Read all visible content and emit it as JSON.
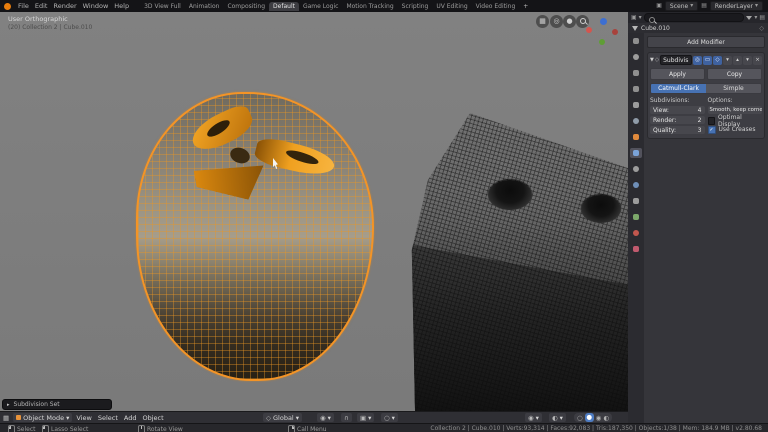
{
  "glyphs": {
    "down": "▾",
    "up": "▴",
    "right": "▸",
    "tri_down": "▼",
    "close": "×",
    "check": "✓",
    "plus": "+",
    "grid": "▦",
    "camera": "◎",
    "hand": "●",
    "target": "◉",
    "half": "◐",
    "circle": "○",
    "diamond": "◇",
    "magnet": "∩",
    "box": "▣",
    "rows": "▤",
    "world": "◍",
    "monitor": "▭"
  },
  "topbar": {
    "menus": [
      "File",
      "Edit",
      "Render",
      "Window",
      "Help"
    ],
    "tabs": [
      "3D View Full",
      "Animation",
      "Compositing",
      "Default",
      "Game Logic",
      "Motion Tracking",
      "Scripting",
      "UV Editing",
      "Video Editing"
    ],
    "active_tab": "Default",
    "scene_label": "Scene",
    "render_layer_label": "RenderLayer"
  },
  "viewport": {
    "view_label": "User Orthographic",
    "context_label": "(20) Collection 2 | Cube.010"
  },
  "outliner": {
    "item": "Cube.010"
  },
  "properties": {
    "tabs": [
      "editor-type",
      "render",
      "output",
      "view-layer",
      "scene",
      "world",
      "object",
      "modifiers",
      "particles",
      "physics",
      "constraints",
      "object-data",
      "material",
      "texture"
    ],
    "active_tab": "modifiers",
    "add_modifier_label": "Add Modifier",
    "modifier": {
      "name": "Subdivis",
      "apply_label": "Apply",
      "copy_label": "Copy",
      "algorithm_catmull": "Catmull-Clark",
      "algorithm_simple": "Simple",
      "subdivisions_label": "Subdivisions:",
      "view_label": "View:",
      "view_value": "4",
      "render_label": "Render:",
      "render_value": "2",
      "quality_label": "Quality:",
      "quality_value": "3",
      "options_label": "Options:",
      "uv_smooth_value": "Smooth, keep corners",
      "optimal_display_label": "Optimal Display",
      "optimal_display_checked": false,
      "use_creases_label": "Use Creases",
      "use_creases_checked": true
    }
  },
  "viewport_header": {
    "mode": "Object Mode",
    "menus": [
      "View",
      "Select",
      "Add",
      "Object"
    ],
    "orientation": "Global"
  },
  "operator_panel": {
    "label": "Subdivision Set"
  },
  "status_bar": {
    "hints": [
      "Select",
      "Lasso Select",
      "Rotate View",
      "Call Menu"
    ],
    "stats": "Collection 2 | Cube.010 | Verts:93,314 | Faces:92,083 | Tris:187,350 | Objects:1/38 | Mem: 184.9 MB | v2.80.68"
  },
  "colors": {
    "accent_blue": "#4772b3",
    "selection_orange": "#f49426"
  }
}
